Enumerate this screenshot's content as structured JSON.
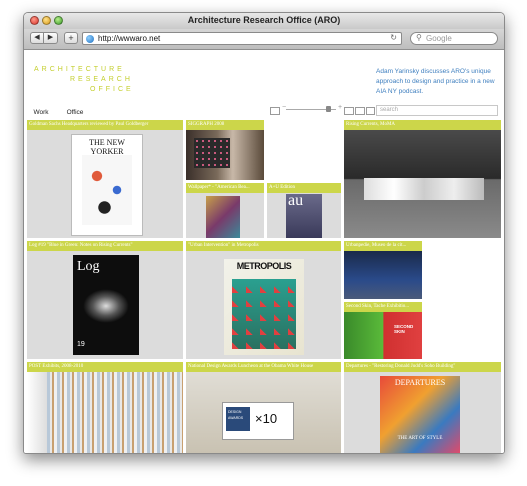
{
  "window": {
    "title": "Architecture Research Office (ARO)"
  },
  "toolbar": {
    "back": "◀",
    "forward": "▶",
    "add": "+",
    "url": "http://wwwaro.net",
    "reload": "↻",
    "search_placeholder": "Google"
  },
  "site": {
    "logo_lines": [
      "ARCHITECTURE",
      "RESEARCH",
      "OFFICE"
    ],
    "headline": "Adam Yarinsky discusses ARO's unique approach to design and practice in a new AIA NY podcast.",
    "tabs": [
      "Work",
      "Office"
    ],
    "search_placeholder": "search"
  },
  "tiles": [
    {
      "caption": "Goldman Sachs Headquarters reviewed by Paul Goldberger",
      "image_text": "THE NEW YORKER"
    },
    {
      "caption": "SIGGRAPH 2008"
    },
    {
      "caption": "Rising Currents, MoMA"
    },
    {
      "caption": "Wallpaper* - \"American Bea..."
    },
    {
      "caption": "A+U Edition",
      "image_text": "au"
    },
    {
      "caption": "Log #19 \"Blue in Green: Notes on Rising Currents\"",
      "image_text": "Log",
      "image_subtext": "19"
    },
    {
      "caption": "\"Urban Intervention\" in Metropolis",
      "image_text": "METROPOLIS"
    },
    {
      "caption": "Urbanpedie, Museo de la cit..."
    },
    {
      "caption": "Second Skin, Tache Exhibitio...",
      "image_text": "SECOND SKIN"
    },
    {
      "caption": "POST Exhibits, 2008-2010"
    },
    {
      "caption": "National Design Awards Luncheon at the Obama White House",
      "image_text": "DESIGN AWARDS",
      "image_subtext": "×10"
    },
    {
      "caption": "Departures - \"Restoring Donald Judd's Soho Building\"",
      "image_text": "DEPARTURES",
      "image_subtext": "THE ART OF STYLE"
    }
  ],
  "colors": {
    "accent": "#ccd64a",
    "link": "#3f7fbf",
    "tile_bg": "#dcdcdc"
  }
}
